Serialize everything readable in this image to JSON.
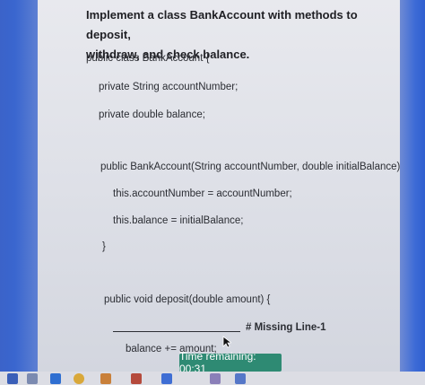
{
  "question": {
    "line1": "Implement a class BankAccount with methods to deposit,",
    "line2": "withdraw, and check balance."
  },
  "code": {
    "class_decl": "public class BankAccount {",
    "field1": "private String accountNumber;",
    "field2": "private double balance;",
    "constructor": "public BankAccount(String accountNumber, double initialBalance) {",
    "assign1": "this.accountNumber = accountNumber;",
    "assign2": "this.balance = initialBalance;",
    "close_brace": "}",
    "deposit_decl": "public void deposit(double amount) {",
    "missing_label": "# Missing Line-1",
    "balance_update": "balance += amount;"
  },
  "timer": {
    "label": "Time remaining: 00:31"
  },
  "taskbar": {
    "icons": [
      "bookmark-icon",
      "grid-icon",
      "browser-icon",
      "chrome-icon",
      "window-icon",
      "app-icon",
      "settings-icon",
      "app-icon-2",
      "app-icon-3"
    ]
  },
  "colors": {
    "timer_bg": "#2e8a73",
    "bezel_blue": "#3b63c9"
  }
}
